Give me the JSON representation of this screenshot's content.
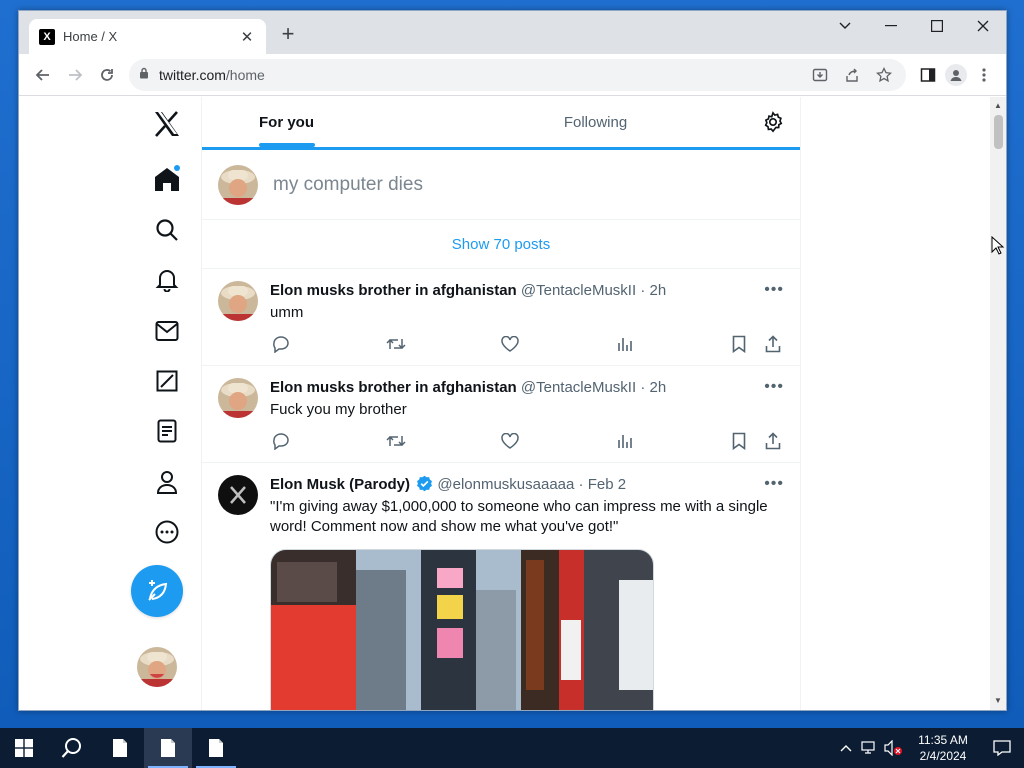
{
  "browser": {
    "tab_title": "Home / X",
    "tab_favicon": "X",
    "new_tab": "+",
    "url_host": "twitter.com",
    "url_path": "/home"
  },
  "feed": {
    "tab_for_you": "For you",
    "tab_following": "Following",
    "composer_text": "my computer dies",
    "show_posts": "Show 70 posts"
  },
  "tweets": [
    {
      "name": "Elon musks brother in afghanistan",
      "handle": "@TentacleMuskII",
      "time": "2h",
      "text": "umm"
    },
    {
      "name": "Elon musks brother in afghanistan",
      "handle": "@TentacleMuskII",
      "time": "2h",
      "text": "Fuck you my brother"
    },
    {
      "name": "Elon Musk (Parody)",
      "handle": "@elonmuskusaaaaa",
      "time": "Feb 2",
      "text": "\"I'm giving away $1,000,000 to someone who can impress me with a single word! Comment now and show me what you've got!\""
    }
  ],
  "taskbar": {
    "time": "11:35 AM",
    "date": "2/4/2024"
  },
  "colors": {
    "accent": "#1d9bf0",
    "text": "#0f1419",
    "muted": "#536471"
  },
  "icons": [
    "x-logo-icon",
    "home-icon",
    "search-icon",
    "bell-icon",
    "mail-icon",
    "grok-icon",
    "lists-icon",
    "profile-icon",
    "more-icon",
    "post-feather-icon",
    "gear-icon",
    "reply-icon",
    "retweet-icon",
    "like-icon",
    "views-icon",
    "bookmark-icon",
    "share-icon",
    "verified-badge-icon"
  ]
}
